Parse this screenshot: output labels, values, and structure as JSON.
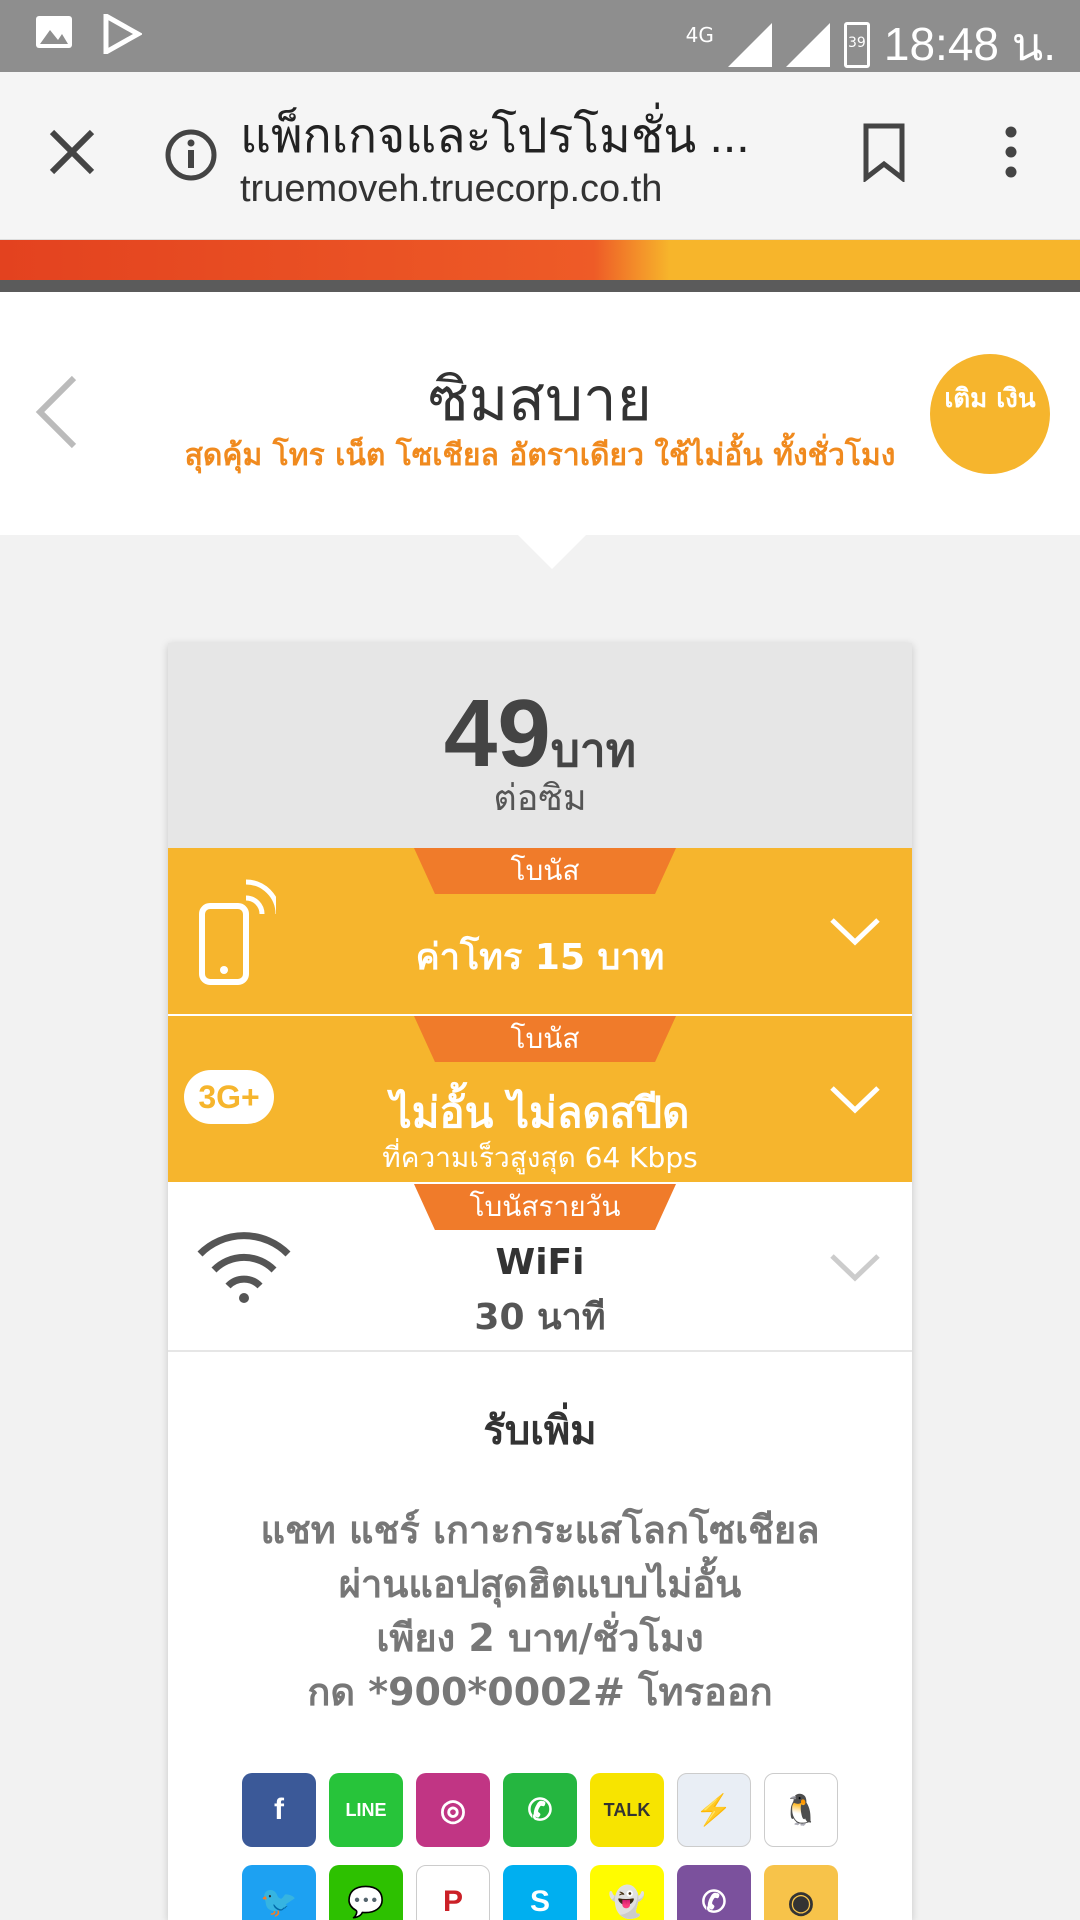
{
  "status_bar": {
    "network": "4G",
    "battery": "39",
    "time": "18:48 น."
  },
  "browser": {
    "title": "แพ็กเกจและโปรโมชั่น ...",
    "url": "truemoveh.truecorp.co.th"
  },
  "header": {
    "title": "ซิมสบาย",
    "subtitle": "สุดคุ้ม โทร เน็ต โซเชียล อัตราเดียว ใช้ไม่อั้น ทั้งชั่วโมง",
    "topup_label": "เติม เงิน"
  },
  "price": {
    "amount": "49",
    "unit": "บาท",
    "per": "ต่อซิม"
  },
  "rows": [
    {
      "tab": "โบนัส",
      "main": "ค่าโทร 15 บาท",
      "sub": ""
    },
    {
      "tab": "โบนัส",
      "main": "ไม่อั้น ไม่ลดสปีด",
      "sub": "ที่ความเร็วสูงสุด 64 Kbps",
      "badge": "3G+"
    },
    {
      "tab": "โบนัสรายวัน",
      "main": "WiFi",
      "sub": "30 นาที"
    }
  ],
  "more": {
    "title": "รับเพิ่ม",
    "lines": [
      "แชท แชร์ เกาะกระแสโลกโซเชียล",
      "ผ่านแอปสุดฮิตแบบไม่อั้น",
      "เพียง 2 บาท/ชั่วโมง",
      "กด *900*0002# โทรออก"
    ]
  },
  "apps": [
    {
      "name": "facebook-icon",
      "glyph": "f",
      "color": "#3b5998"
    },
    {
      "name": "line-icon",
      "glyph": "LINE",
      "color": "#27c43a"
    },
    {
      "name": "instagram-icon",
      "glyph": "◎",
      "color": "#c13584"
    },
    {
      "name": "whatsapp-icon",
      "glyph": "✆",
      "color": "#25b640"
    },
    {
      "name": "kakaotalk-icon",
      "glyph": "TALK",
      "color": "#f7e400"
    },
    {
      "name": "messenger-icon",
      "glyph": "⚡",
      "color": "#e9eef5"
    },
    {
      "name": "qq-icon",
      "glyph": "🐧",
      "color": "#ffffff"
    },
    {
      "name": "twitter-icon",
      "glyph": "🐦",
      "color": "#1da1f2"
    },
    {
      "name": "wechat-icon",
      "glyph": "💬",
      "color": "#2dc100"
    },
    {
      "name": "pinterest-icon",
      "glyph": "P",
      "color": "#ffffff"
    },
    {
      "name": "skype-icon",
      "glyph": "S",
      "color": "#00aff0"
    },
    {
      "name": "snapchat-icon",
      "glyph": "👻",
      "color": "#fffc00"
    },
    {
      "name": "viber-icon",
      "glyph": "✆",
      "color": "#7b519d"
    },
    {
      "name": "weibo-icon",
      "glyph": "◉",
      "color": "#f7c34a"
    }
  ],
  "colors": {
    "accent_orange": "#f6b52d",
    "tab_orange": "#f07b2a",
    "subtitle_orange": "#f08a1e"
  }
}
